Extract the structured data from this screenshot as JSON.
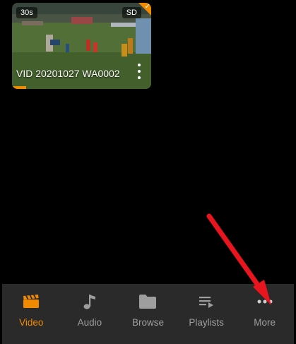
{
  "colors": {
    "accent": "#f08a00",
    "nav_bg": "#2a2a2a",
    "label_inactive": "#9e9e9e",
    "annotation_arrow": "#e8141e"
  },
  "video": {
    "duration": "30s",
    "quality": "SD",
    "title": "VID 20201027 WA0002",
    "progress": 0.1
  },
  "bottom_nav": {
    "items": [
      {
        "label": "Video",
        "icon": "video-clapper-icon",
        "active": true
      },
      {
        "label": "Audio",
        "icon": "music-note-icon",
        "active": false
      },
      {
        "label": "Browse",
        "icon": "folder-icon",
        "active": false
      },
      {
        "label": "Playlists",
        "icon": "playlist-icon",
        "active": false
      },
      {
        "label": "More",
        "icon": "more-horizontal-icon",
        "active": false
      }
    ]
  }
}
